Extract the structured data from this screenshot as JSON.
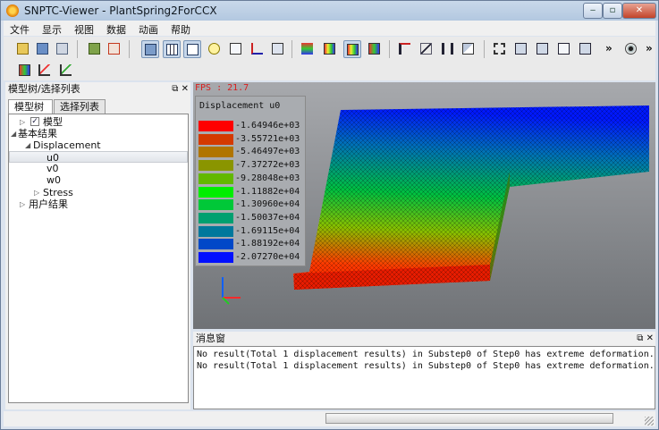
{
  "window": {
    "title": "SNPTC-Viewer - PlantSpring2ForCCX"
  },
  "menu": [
    "文件",
    "显示",
    "视图",
    "数据",
    "动画",
    "帮助"
  ],
  "toolbar": {
    "more_glyph": "»"
  },
  "tree_panel": {
    "title": "模型树/选择列表",
    "controls": "⧉ ✕",
    "tabs": [
      "模型树",
      "选择列表"
    ],
    "items": [
      {
        "label": "模型",
        "checked": true,
        "expanded": false
      },
      {
        "label": "基本结果",
        "expanded": true
      },
      {
        "label": "Displacement",
        "expanded": true
      },
      {
        "label": "u0",
        "selected": true
      },
      {
        "label": "v0"
      },
      {
        "label": "w0"
      },
      {
        "label": "Stress",
        "expanded": false
      },
      {
        "label": "用户结果",
        "expanded": false
      }
    ]
  },
  "viewport": {
    "fps": "FPS : 21.7",
    "legend": {
      "title": "Displacement u0",
      "entries": [
        {
          "value": "-1.64946e+03",
          "color": "#ff0000"
        },
        {
          "value": "-3.55721e+03",
          "color": "#d43a00"
        },
        {
          "value": "-5.46497e+03",
          "color": "#b07500"
        },
        {
          "value": "-7.37272e+03",
          "color": "#8a9500"
        },
        {
          "value": "-9.28048e+03",
          "color": "#62b800"
        },
        {
          "value": "-1.11882e+04",
          "color": "#00ee00"
        },
        {
          "value": "-1.30960e+04",
          "color": "#00c838"
        },
        {
          "value": "-1.50037e+04",
          "color": "#00a070"
        },
        {
          "value": "-1.69115e+04",
          "color": "#00789c"
        },
        {
          "value": "-1.88192e+04",
          "color": "#0048c8"
        },
        {
          "value": "-2.07270e+04",
          "color": "#0010ff"
        }
      ]
    }
  },
  "message_panel": {
    "title": "消息窗",
    "controls": "⧉ ✕",
    "lines": [
      "No result(Total 1 displacement results) in Substep0 of Step0 has extreme deformation.",
      "No result(Total 1 displacement results) in Substep0 of Step0 has extreme deformation."
    ]
  }
}
